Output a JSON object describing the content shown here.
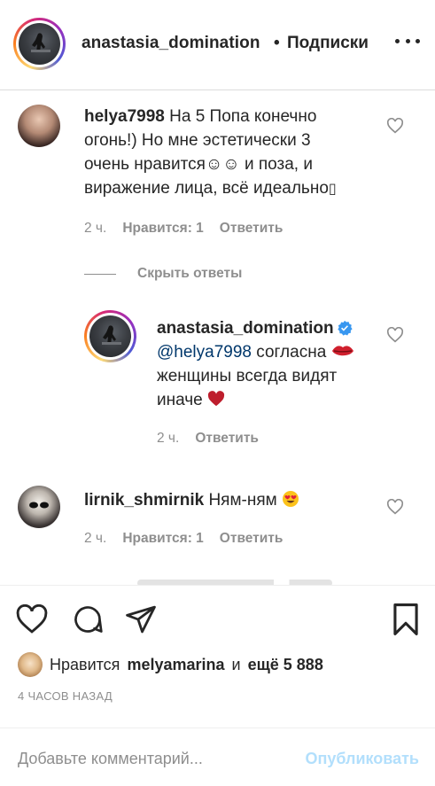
{
  "header": {
    "username": "anastasia_domination",
    "separator": "•",
    "follow_status": "Подписки"
  },
  "comments": [
    {
      "username": "helya7998",
      "text": "На 5 Попа конечно огонь!) Но мне эстетически 3 очень нравится☺☺ и поза, и виражение лица, всё идеально",
      "line1": "На 5 Попа конечно",
      "line2": "огонь!) Но мне эстетически 3",
      "line3": "очень нравится☺☺ и поза, и",
      "line4": "виражение лица, всё идеально",
      "tail_glyph": "▯",
      "time": "2 ч.",
      "likes": "Нравится: 1",
      "reply": "Ответить"
    },
    {
      "username": "lirnik_shmirnik",
      "text": "Ням-ням",
      "emoji": "😍",
      "time": "2 ч.",
      "likes": "Нравится: 1",
      "reply": "Ответить"
    }
  ],
  "hide_replies": "Скрыть ответы",
  "reply": {
    "username": "anastasia_domination",
    "mention": "@helya7998",
    "line1_rest": "согласна",
    "line2": "женщины всегда видят",
    "line3": "иначе",
    "time": "2 ч.",
    "reply": "Ответить"
  },
  "post": {
    "liked_by_prefix": "Нравится",
    "liked_by_user": "melyamarina",
    "liked_by_conj": "и",
    "liked_by_others": "ещё 5 888",
    "time_ago": "4 ЧАСОВ НАЗАД"
  },
  "comment_input": {
    "placeholder": "Добавьте комментарий...",
    "publish": "Опубликовать"
  },
  "colors": {
    "text": "#262626",
    "secondary": "#8e8e8e",
    "mention": "#00376b",
    "verified": "#3897f0",
    "publish_disabled": "#b2dffc",
    "heart": "#d0202e"
  }
}
